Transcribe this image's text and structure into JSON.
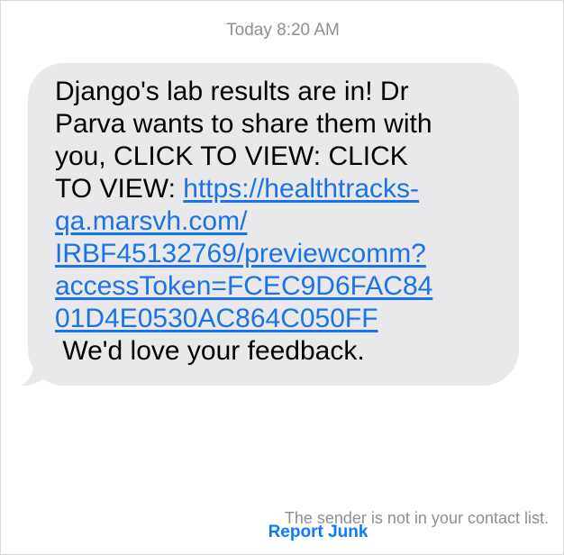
{
  "header": {
    "timestamp_day": "Today",
    "timestamp_time": "8:20 AM"
  },
  "message": {
    "lines": [
      "Django's lab results are in! Dr",
      "Parva wants to share them with",
      "you, CLICK TO VIEW: CLICK",
      "TO VIEW: "
    ],
    "link_lines": [
      "https://healthtracks-",
      "qa.marsvh.com/",
      "IRBF45132769/previewcomm?",
      "accessToken=FCEC9D6FAC84",
      "01D4E0530AC864C050FF"
    ],
    "closing": " We'd love your feedback."
  },
  "footer": {
    "notice": "The sender is not in your contact list.",
    "report_label": "Report Junk"
  },
  "colors": {
    "bubble_background": "#e9e9eb",
    "link": "#1a73e8",
    "secondary_text": "#8e8e93",
    "action": "#0a7aff"
  }
}
